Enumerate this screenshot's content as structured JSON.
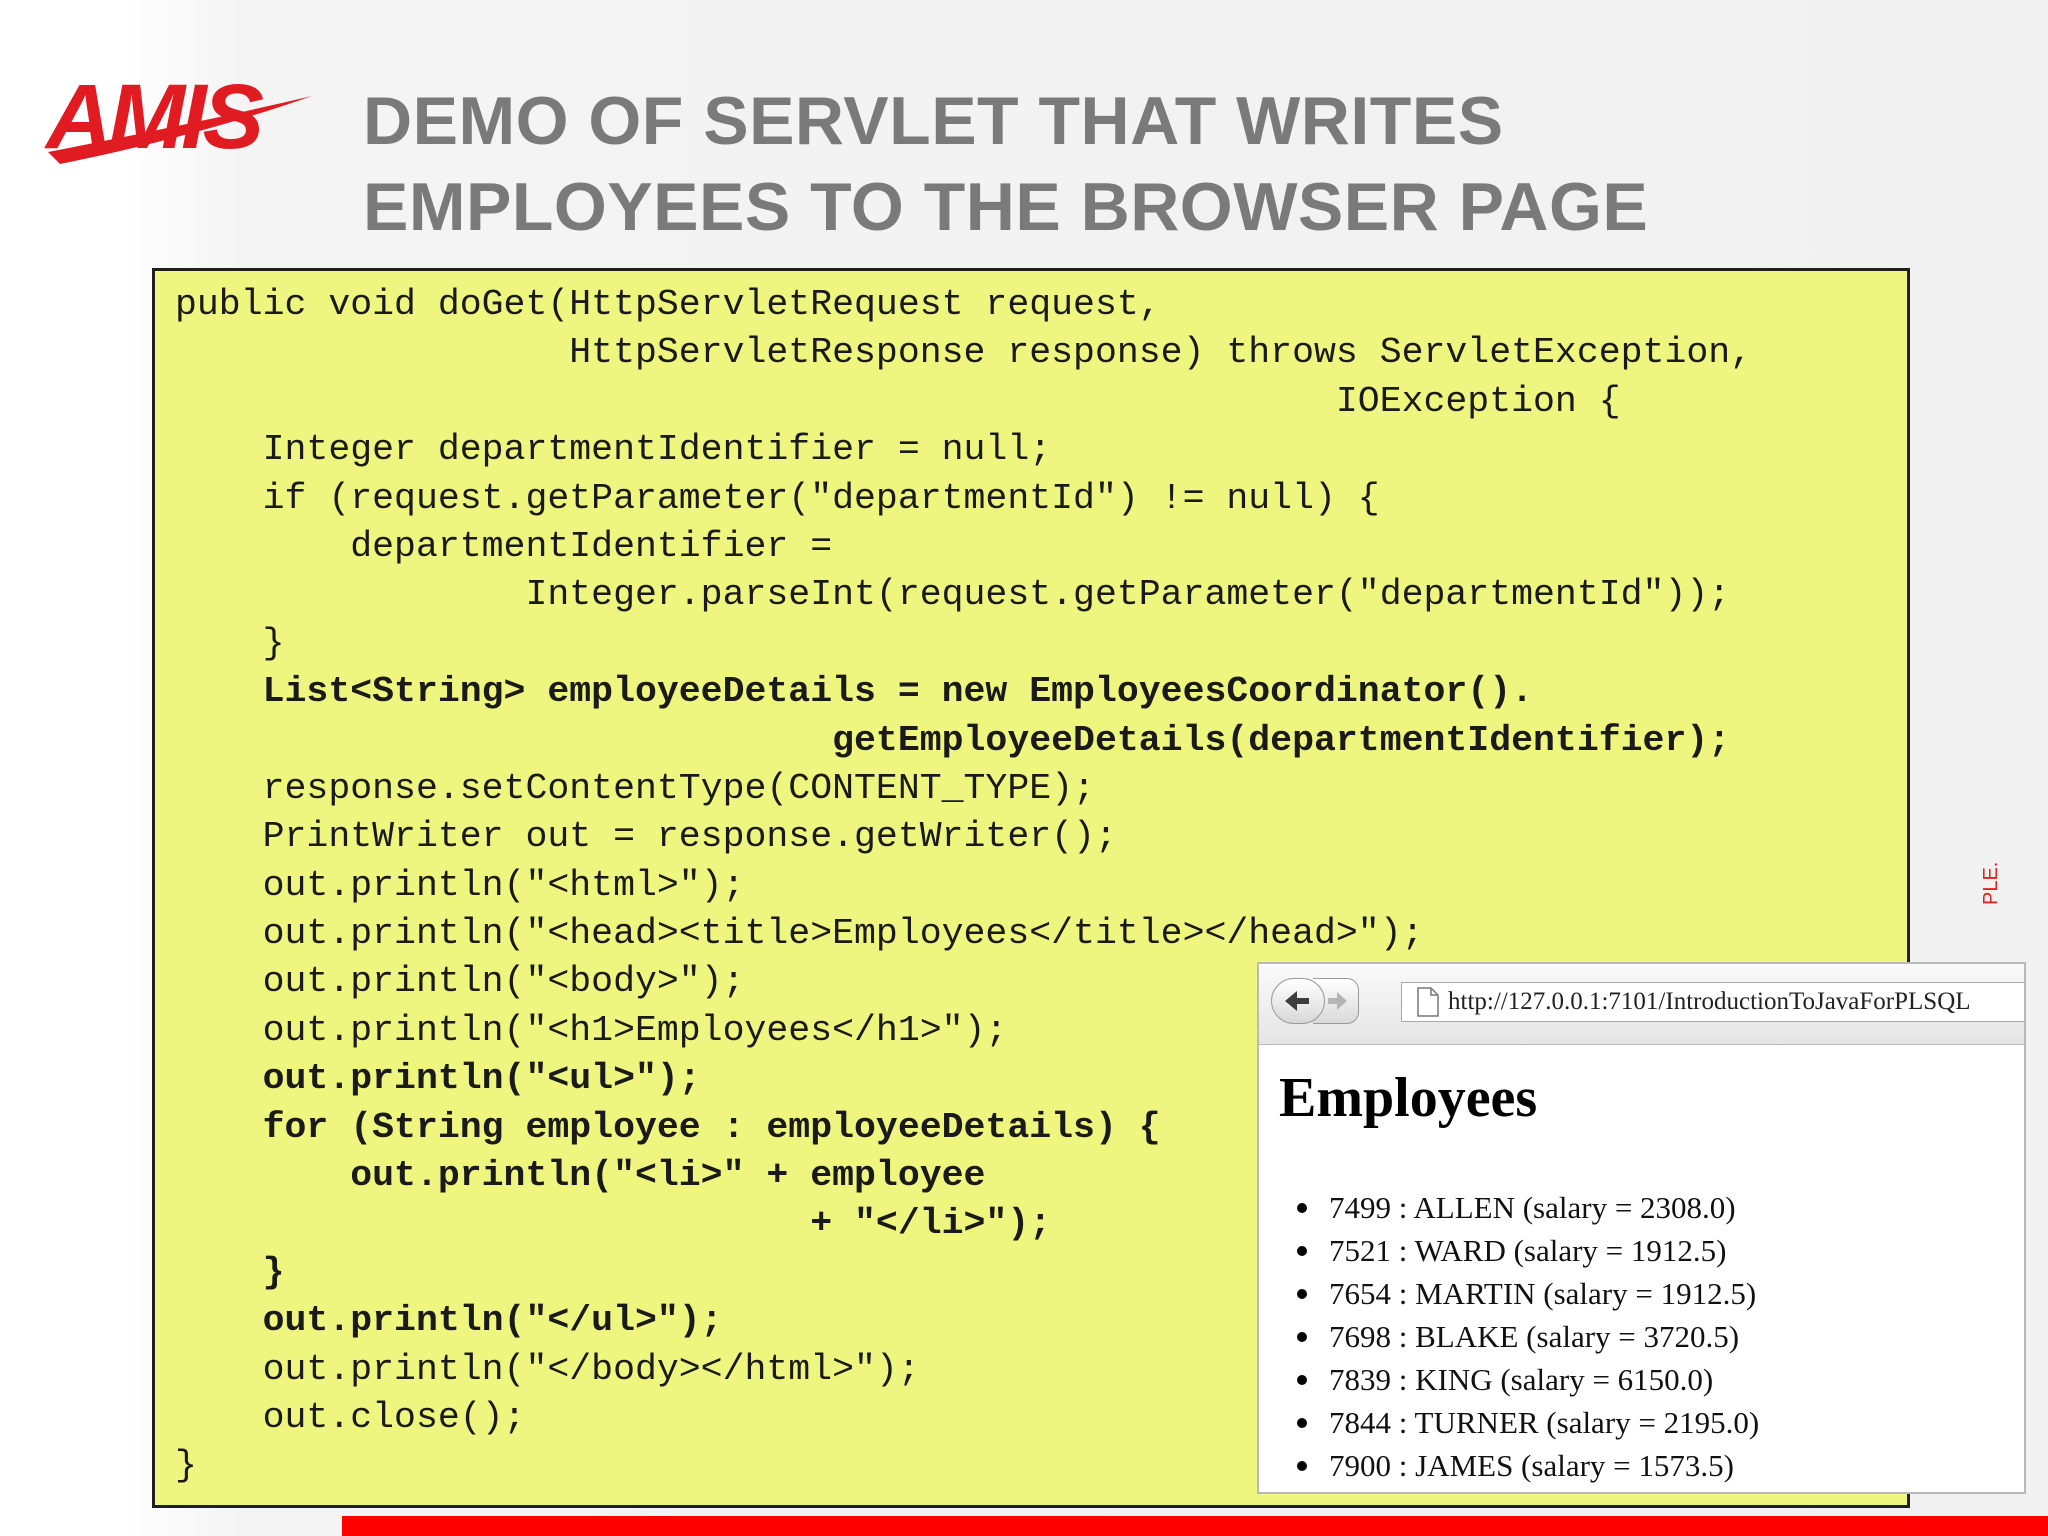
{
  "slide": {
    "logo_text": "AMIS",
    "title_lines": [
      "DEMO OF SERVLET THAT WRITES",
      "EMPLOYEES TO THE BROWSER PAGE"
    ],
    "side_text": "PLE."
  },
  "code": {
    "lines": [
      {
        "text": "public void doGet(HttpServletRequest request,",
        "bold": false
      },
      {
        "text": "                  HttpServletResponse response) throws ServletException,",
        "bold": false
      },
      {
        "text": "                                                     IOException {",
        "bold": false
      },
      {
        "text": "    Integer departmentIdentifier = null;",
        "bold": false
      },
      {
        "text": "    if (request.getParameter(\"departmentId\") != null) {",
        "bold": false
      },
      {
        "text": "        departmentIdentifier =",
        "bold": false
      },
      {
        "text": "                Integer.parseInt(request.getParameter(\"departmentId\"));",
        "bold": false
      },
      {
        "text": "    }",
        "bold": false
      },
      {
        "text": "    List<String> employeeDetails = new EmployeesCoordinator().",
        "bold": true
      },
      {
        "text": "                              getEmployeeDetails(departmentIdentifier);",
        "bold": true
      },
      {
        "text": "    response.setContentType(CONTENT_TYPE);",
        "bold": false
      },
      {
        "text": "    PrintWriter out = response.getWriter();",
        "bold": false
      },
      {
        "text": "    out.println(\"<html>\");",
        "bold": false
      },
      {
        "text": "    out.println(\"<head><title>Employees</title></head>\");",
        "bold": false
      },
      {
        "text": "    out.println(\"<body>\");",
        "bold": false
      },
      {
        "text": "    out.println(\"<h1>Employees</h1>\");",
        "bold": false
      },
      {
        "text": "    out.println(\"<ul>\");",
        "bold": true
      },
      {
        "text": "    for (String employee : employeeDetails) {",
        "bold": true
      },
      {
        "text": "        out.println(\"<li>\" + employee",
        "bold": true
      },
      {
        "text": "                             + \"</li>\");",
        "bold": true
      },
      {
        "text": "    }",
        "bold": true
      },
      {
        "text": "    out.println(\"</ul>\");",
        "bold": true
      },
      {
        "text": "    out.println(\"</body></html>\");",
        "bold": false
      },
      {
        "text": "    out.close();",
        "bold": false
      },
      {
        "text": "}",
        "bold": false
      }
    ]
  },
  "browser": {
    "url": "http://127.0.0.1:7101/IntroductionToJavaForPLSQL",
    "heading": "Employees",
    "employees": [
      "7499 : ALLEN (salary = 2308.0)",
      "7521 : WARD (salary = 1912.5)",
      "7654 : MARTIN (salary = 1912.5)",
      "7698 : BLAKE (salary = 3720.5)",
      "7839 : KING (salary = 6150.0)",
      "7844 : TURNER (salary = 2195.0)",
      "7900 : JAMES (salary = 1573.5)"
    ]
  },
  "colors": {
    "accent_red": "#ff0000",
    "code_background": "#eef67f",
    "title_gray": "#7a7a7a"
  }
}
